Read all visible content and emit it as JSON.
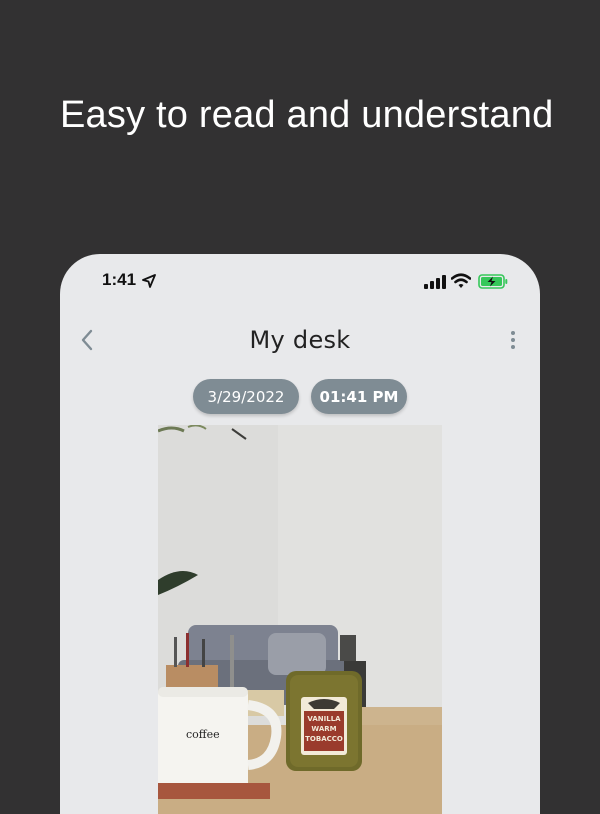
{
  "promo": {
    "headline": "Easy to read and understand"
  },
  "status_bar": {
    "time": "1:41"
  },
  "nav": {
    "title": "My desk"
  },
  "entry": {
    "date": "3/29/2022",
    "time": "01:41 PM"
  },
  "photo": {
    "mug_text": "coffee",
    "candle_label": [
      "VANILLA",
      "WARM",
      "TOBACCO"
    ]
  },
  "colors": {
    "background": "#323132",
    "phone_bg": "#e8e9eb",
    "chip": "#7f8c94",
    "accent_icon": "#7f8c94",
    "battery": "#35c759"
  },
  "icons": [
    "location-arrow-icon",
    "cellular-signal-icon",
    "wifi-icon",
    "battery-charging-icon",
    "chevron-left-icon",
    "more-vertical-icon"
  ]
}
